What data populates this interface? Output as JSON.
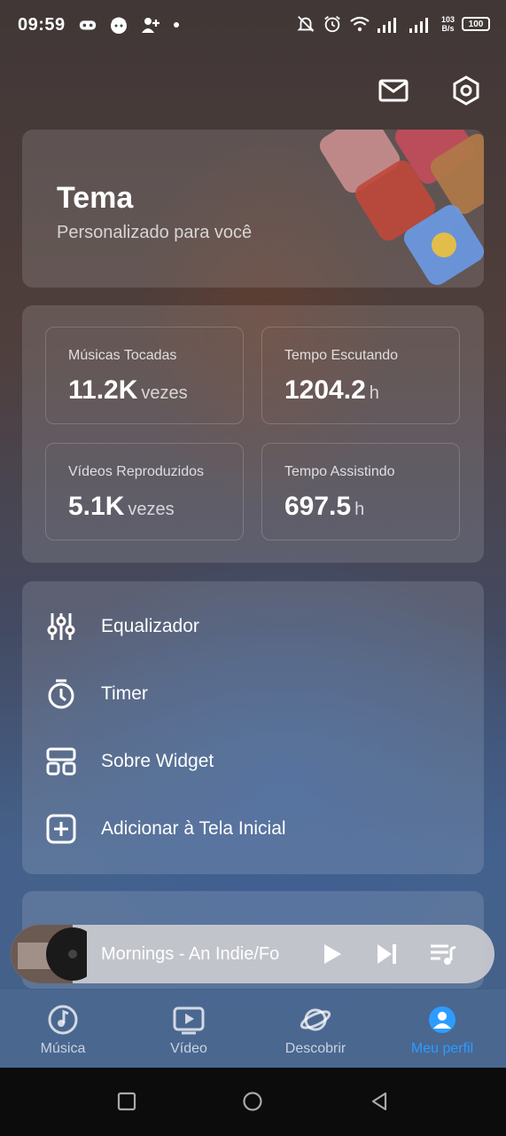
{
  "status_bar": {
    "time": "09:59",
    "net_speed_value": "103",
    "net_speed_unit": "B/s",
    "battery": "100"
  },
  "top_actions": {
    "mail_icon": "mail-icon",
    "settings_icon": "settings-hexagon-icon"
  },
  "theme_card": {
    "title": "Tema",
    "subtitle": "Personalizado para você"
  },
  "stats": [
    {
      "label": "Músicas Tocadas",
      "value": "11.2K",
      "unit": "vezes"
    },
    {
      "label": "Tempo Escutando",
      "value": "1204.2",
      "unit": "h"
    },
    {
      "label": "Vídeos Reproduzidos",
      "value": "5.1K",
      "unit": "vezes"
    },
    {
      "label": "Tempo Assistindo",
      "value": "697.5",
      "unit": "h"
    }
  ],
  "menu": [
    {
      "label": "Equalizador",
      "icon": "equalizer-icon"
    },
    {
      "label": "Timer",
      "icon": "timer-icon"
    },
    {
      "label": "Sobre Widget",
      "icon": "widget-icon"
    },
    {
      "label": "Adicionar à Tela Inicial",
      "icon": "add-square-icon"
    }
  ],
  "player": {
    "title": "Mornings  - An Indie/Fo"
  },
  "bottom_nav": [
    {
      "label": "Música",
      "icon": "music-disc-icon",
      "active": false
    },
    {
      "label": "Vídeo",
      "icon": "video-play-icon",
      "active": false
    },
    {
      "label": "Descobrir",
      "icon": "planet-icon",
      "active": false
    },
    {
      "label": "Meu perfil",
      "icon": "profile-icon",
      "active": true
    }
  ],
  "colors": {
    "accent": "#2d9cff",
    "card_bg": "rgba(255,255,255,0.13)"
  }
}
